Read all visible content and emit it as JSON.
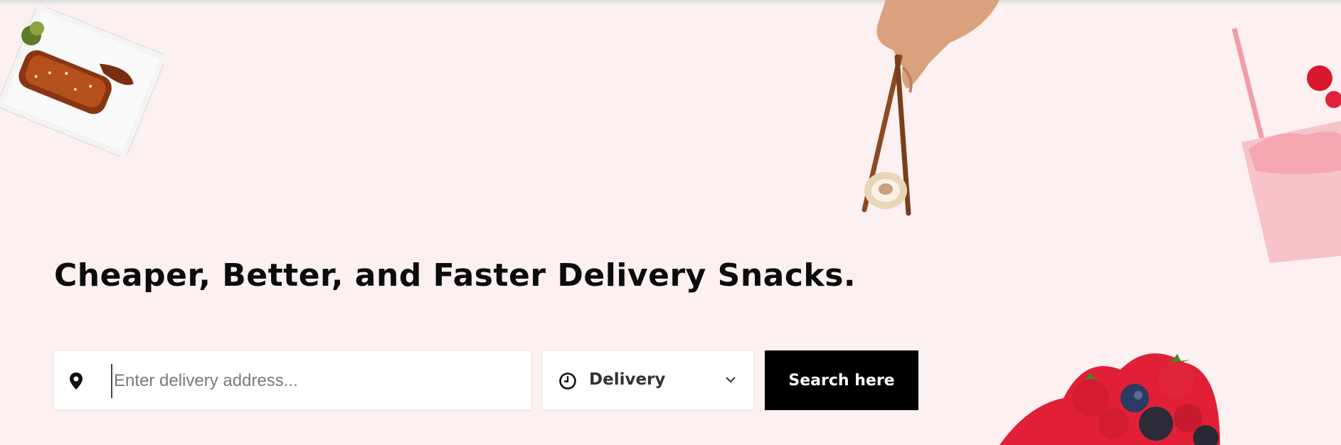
{
  "hero": {
    "title": "Cheaper, Better, and Faster Delivery Snacks."
  },
  "search": {
    "address_placeholder": "Enter delivery address...",
    "address_value": "",
    "mode_selected": "Delivery",
    "button_label": "Search here"
  },
  "icons": {
    "location": "map-pin-icon",
    "time": "clock-icon",
    "dropdown": "chevron-down-icon"
  },
  "colors": {
    "background": "#fcf0f1",
    "button_bg": "#000000",
    "button_text": "#ffffff",
    "heading": "#0b0b0b"
  }
}
